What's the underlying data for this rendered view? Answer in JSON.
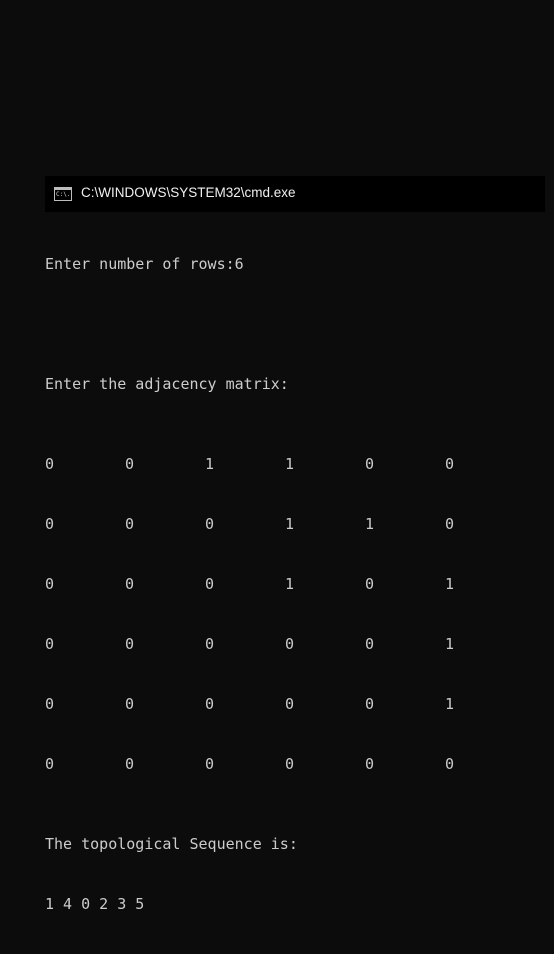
{
  "window": {
    "title": "C:\\WINDOWS\\SYSTEM32\\cmd.exe",
    "icon": "cmd-icon",
    "icon_text": "C:\\."
  },
  "console": {
    "rows_prompt": "Enter number of rows:6",
    "matrix_prompt": "Enter the adjacency matrix:",
    "matrix": [
      [
        "0",
        "0",
        "1",
        "1",
        "0",
        "0"
      ],
      [
        "0",
        "0",
        "0",
        "1",
        "1",
        "0"
      ],
      [
        "0",
        "0",
        "0",
        "1",
        "0",
        "1"
      ],
      [
        "0",
        "0",
        "0",
        "0",
        "0",
        "1"
      ],
      [
        "0",
        "0",
        "0",
        "0",
        "0",
        "1"
      ],
      [
        "0",
        "0",
        "0",
        "0",
        "0",
        "0"
      ]
    ],
    "result_heading": "The topological Sequence is:",
    "result": "1 4 0 2 3 5"
  },
  "colors": {
    "background": "#0c0c0c",
    "titlebar": "#000000",
    "text": "#cccccc"
  }
}
